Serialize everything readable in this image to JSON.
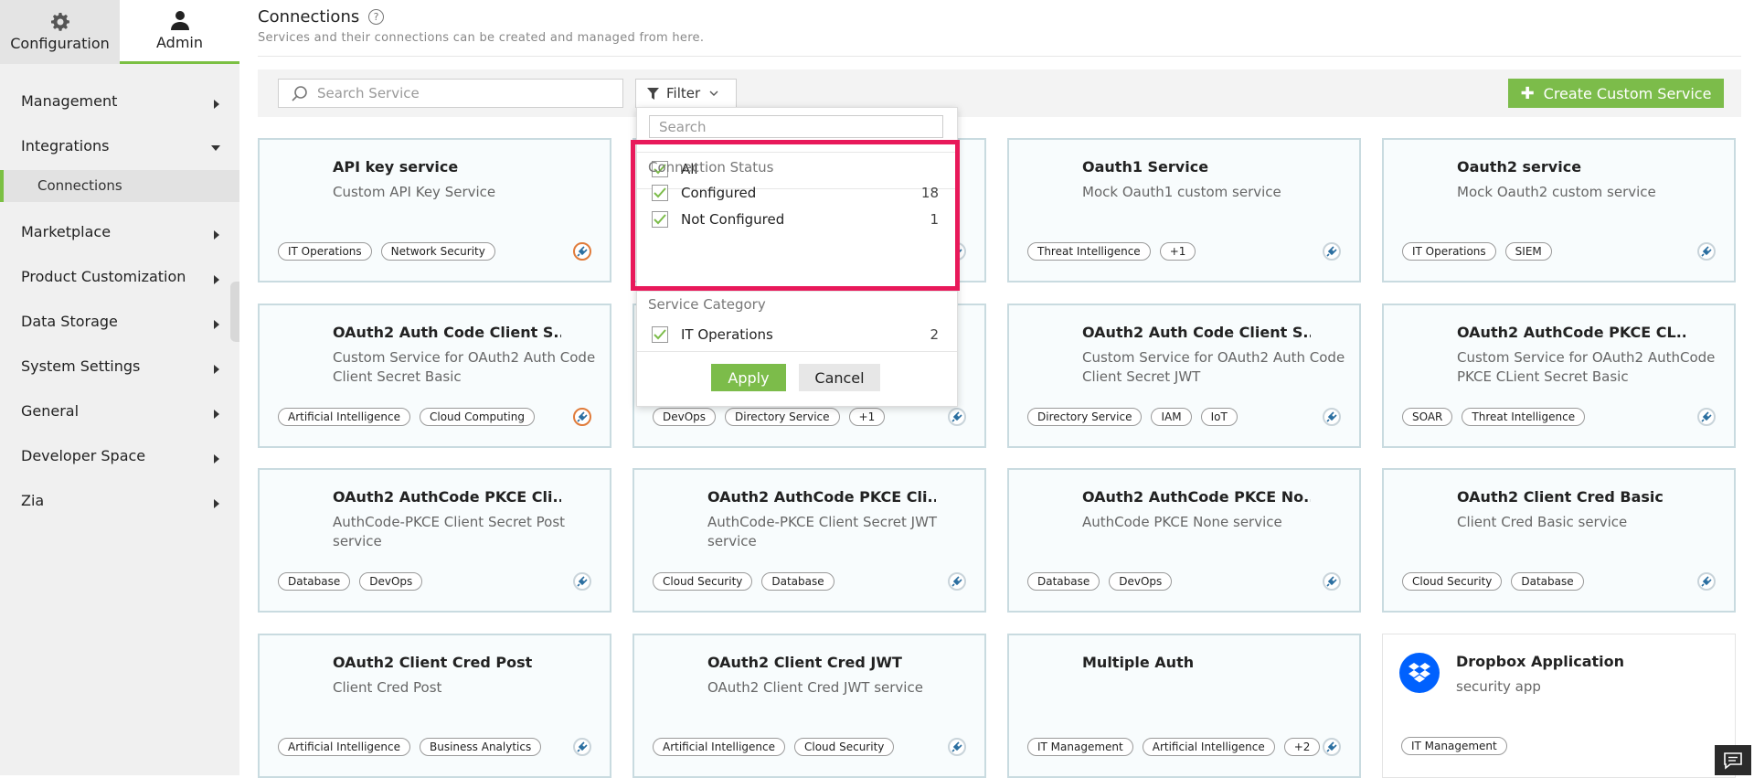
{
  "topnav": {
    "configuration": "Configuration",
    "admin": "Admin"
  },
  "sidebar": {
    "items": [
      {
        "label": "Management"
      },
      {
        "label": "Integrations"
      },
      {
        "label": "Marketplace"
      },
      {
        "label": "Product Customization"
      },
      {
        "label": "Data Storage"
      },
      {
        "label": "System Settings"
      },
      {
        "label": "General"
      },
      {
        "label": "Developer Space"
      },
      {
        "label": "Zia"
      }
    ],
    "sub_connections": "Connections"
  },
  "header": {
    "title": "Connections",
    "subtitle": "Services and their connections can be created and managed from here."
  },
  "toolbar": {
    "search_placeholder": "Search Service",
    "filter_label": "Filter",
    "create_label": "Create Custom Service"
  },
  "filter": {
    "search_placeholder": "Search",
    "all_label": "All",
    "connection_status_label": "Connection Status",
    "configured_label": "Configured",
    "configured_count": "18",
    "not_configured_label": "Not Configured",
    "not_configured_count": "1",
    "service_category_label": "Service Category",
    "it_operations_label": "IT Operations",
    "it_operations_count": "2",
    "apply_label": "Apply",
    "cancel_label": "Cancel"
  },
  "cards": [
    {
      "title": "API key service",
      "desc": "Custom API Key Service",
      "tags": [
        "IT Operations",
        "Network Security"
      ]
    },
    {
      "title": "",
      "desc": "",
      "tags": []
    },
    {
      "title": "Oauth1 Service",
      "desc": "Mock Oauth1 custom service",
      "tags": [
        "Threat Intelligence",
        "+1"
      ]
    },
    {
      "title": "Oauth2 service",
      "desc": "Mock Oauth2 custom service",
      "tags": [
        "IT Operations",
        "SIEM"
      ]
    },
    {
      "title": "OAuth2 Auth Code Client S...",
      "desc": "Custom Service for OAuth2 Auth Code Client Secret Basic",
      "tags": [
        "Artificial Intelligence",
        "Cloud Computing"
      ]
    },
    {
      "title": "",
      "desc": "",
      "tags": [
        "DevOps",
        "Directory Service",
        "+1"
      ]
    },
    {
      "title": "OAuth2 Auth Code Client S...",
      "desc": "Custom Service for OAuth2 Auth Code Client Secret JWT",
      "tags": [
        "Directory Service",
        "IAM",
        "IoT"
      ]
    },
    {
      "title": "OAuth2 AuthCode PKCE CL...",
      "desc": "Custom Service for OAuth2 AuthCode PKCE CLient Secret Basic",
      "tags": [
        "SOAR",
        "Threat Intelligence"
      ]
    },
    {
      "title": "OAuth2 AuthCode PKCE Cli...",
      "desc": "AuthCode-PKCE Client Secret Post service",
      "tags": [
        "Database",
        "DevOps"
      ]
    },
    {
      "title": "OAuth2 AuthCode PKCE Cli...",
      "desc": "AuthCode-PKCE Client Secret JWT service",
      "tags": [
        "Cloud Security",
        "Database"
      ]
    },
    {
      "title": "OAuth2 AuthCode PKCE No...",
      "desc": "AuthCode PKCE None service",
      "tags": [
        "Database",
        "DevOps"
      ]
    },
    {
      "title": "OAuth2 Client Cred Basic",
      "desc": "Client Cred Basic service",
      "tags": [
        "Cloud Security",
        "Database"
      ]
    },
    {
      "title": "OAuth2 Client Cred Post",
      "desc": "Client Cred Post",
      "tags": [
        "Artificial Intelligence",
        "Business Analytics"
      ]
    },
    {
      "title": "OAuth2 Client Cred JWT",
      "desc": "OAuth2 Client Cred JWT service",
      "tags": [
        "Artificial Intelligence",
        "Cloud Security"
      ]
    },
    {
      "title": "Multiple Auth",
      "desc": "",
      "tags": [
        "IT Management",
        "Artificial Intelligence",
        "+2"
      ]
    },
    {
      "title": "Dropbox Application",
      "desc": "security app",
      "tags": [
        "IT Management"
      ]
    }
  ],
  "colors": {
    "accent": "#7cbc4a",
    "highlight": "#e8195a",
    "card_border": "#c9dbe0",
    "unconfigured": "#e07b3a"
  },
  "icons": {
    "config": "gear-icon",
    "admin": "user-icon",
    "help": "help-icon",
    "search": "search-icon",
    "filter": "funnel-icon",
    "status": "plug-icon",
    "dropbox": "dropbox-icon",
    "chat": "chat-icon"
  }
}
